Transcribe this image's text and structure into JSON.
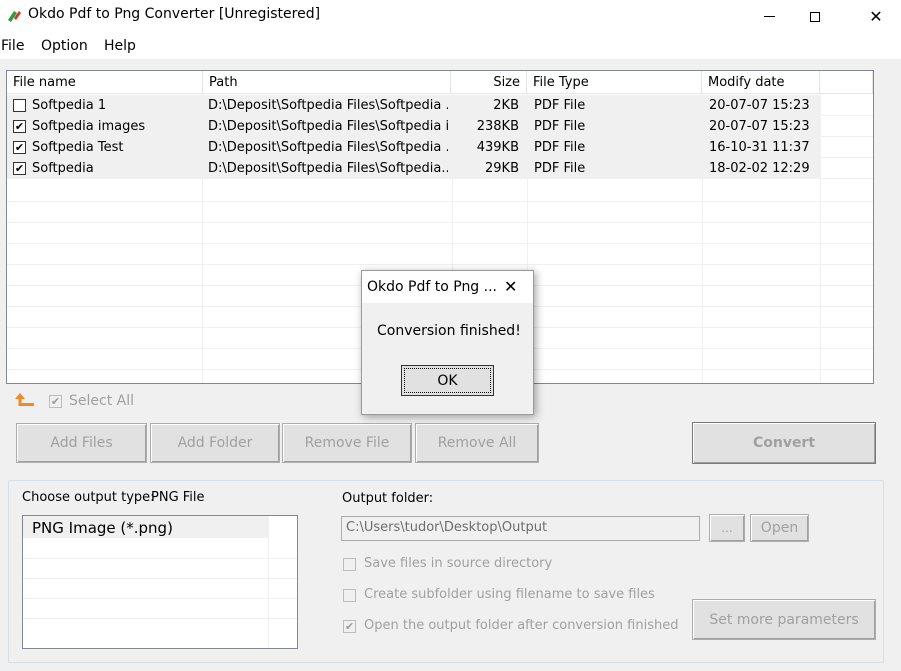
{
  "window": {
    "title": "Okdo Pdf to Png Converter [Unregistered]",
    "minimize": "—",
    "maximize": "☐",
    "close": "✕"
  },
  "menu": [
    "File",
    "Option",
    "Help"
  ],
  "columns": [
    "File name",
    "Path",
    "Size",
    "File Type",
    "Modify date"
  ],
  "files": [
    {
      "checked": false,
      "name": "Softpedia 1",
      "path": "D:\\Deposit\\Softpedia Files\\Softpedia ...",
      "size": "2KB",
      "type": "PDF File",
      "date": "20-07-07 15:23"
    },
    {
      "checked": true,
      "name": "Softpedia images",
      "path": "D:\\Deposit\\Softpedia Files\\Softpedia i...",
      "size": "238KB",
      "type": "PDF File",
      "date": "20-07-07 15:23"
    },
    {
      "checked": true,
      "name": "Softpedia Test",
      "path": "D:\\Deposit\\Softpedia Files\\Softpedia ...",
      "size": "439KB",
      "type": "PDF File",
      "date": "16-10-31 11:37"
    },
    {
      "checked": true,
      "name": "Softpedia",
      "path": "D:\\Deposit\\Softpedia Files\\Softpedia....",
      "size": "29KB",
      "type": "PDF File",
      "date": "18-02-02 12:29"
    }
  ],
  "toolbar": {
    "select_all": "Select All",
    "add_files": "Add Files",
    "add_folder": "Add Folder",
    "remove_file": "Remove File",
    "remove_all": "Remove All",
    "convert": "Convert"
  },
  "output": {
    "type_label": "Choose output type:",
    "type_value": "PNG File",
    "types": [
      "PNG Image (*.png)"
    ],
    "folder_label": "Output folder:",
    "folder_value": "C:\\Users\\tudor\\Desktop\\Output",
    "browse": "...",
    "open": "Open",
    "opt_source_dir": "Save files in source directory",
    "opt_subfolder": "Create subfolder using filename to save files",
    "opt_open_folder": "Open the output folder after conversion finished",
    "set_more": "Set more parameters"
  },
  "dialog": {
    "title": "Okdo Pdf to Png ...",
    "message": "Conversion finished!",
    "ok": "OK"
  },
  "colors": {
    "accent_orange": "#f08a24",
    "title_icon_green": "#2e9e3a",
    "title_icon_red": "#d9342b"
  }
}
